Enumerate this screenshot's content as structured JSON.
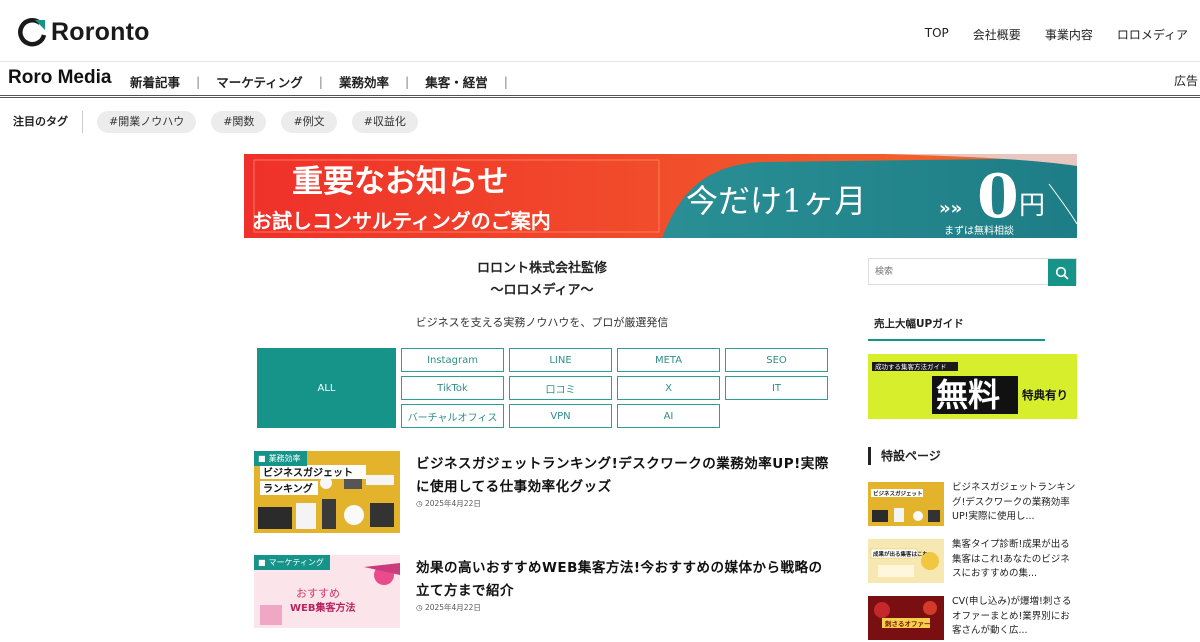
{
  "header": {
    "logo_text": "Roronto",
    "nav": [
      "TOP",
      "会社概要",
      "事業内容",
      "ロロメディア"
    ]
  },
  "category_bar": {
    "brand": "Roro Media",
    "categories": [
      "新着記事",
      "マーケティング",
      "業務効率",
      "集客・経営"
    ],
    "ad_label": "広告"
  },
  "tags": {
    "title": "注目のタグ",
    "items": [
      "#開業ノウハウ",
      "#関数",
      "#例文",
      "#収益化"
    ]
  },
  "banner": {
    "headline": "重要なお知らせ",
    "subline": "お試しコンサルティングのご案内",
    "offer_prefix": "今だけ1ヶ月",
    "offer_value": "0",
    "offer_unit": "円",
    "note": "まずは無料相談"
  },
  "intro": {
    "supervisor": "ロロント株式会社監修",
    "media_name": "〜ロロメディア〜",
    "description": "ビジネスを支える実務ノウハウを、プロが厳選発信"
  },
  "filters": {
    "all_label": "ALL",
    "buttons": [
      "Instagram",
      "LINE",
      "META",
      "SEO",
      "TikTok",
      "口コミ",
      "X",
      "IT",
      "バーチャルオフィス",
      "VPN",
      "AI"
    ]
  },
  "articles": [
    {
      "category": "業務効率",
      "thumb_text_1": "ビジネスガジェット",
      "thumb_text_2": "ランキング",
      "title": "ビジネスガジェットランキング!デスクワークの業務効率UP!実際に使用してる仕事効率化グッズ",
      "date": "2025年4月22日"
    },
    {
      "category": "マーケティング",
      "thumb_text_1": "おすすめ",
      "thumb_text_2": "WEB集客方法",
      "title": "効果の高いおすすめWEB集客方法!今おすすめの媒体から戦略の立て方まで紹介",
      "date": "2025年4月22日"
    }
  ],
  "sidebar": {
    "search_placeholder": "検索",
    "guide_heading": "売上大幅UPガイド",
    "guide_banner": {
      "tag": "成功する集客方法ガイド",
      "main": "無料",
      "sub": "特典有り"
    },
    "feature_heading": "特設ページ",
    "features": [
      {
        "title": "ビジネスガジェットランキング!デスクワークの業務効率UP!実際に使用し...",
        "thumb_text": "ビジネスガジェット"
      },
      {
        "title": "集客タイプ診断!成果が出る集客はこれ!あなたのビジネスにおすすめの集...",
        "thumb_text": "成果が出る集客はこれ!"
      },
      {
        "title": "CV(申し込み)が爆増!刺さるオファーまとめ!業界別にお客さんが動く広...",
        "thumb_text": "刺さるオファー"
      }
    ]
  }
}
